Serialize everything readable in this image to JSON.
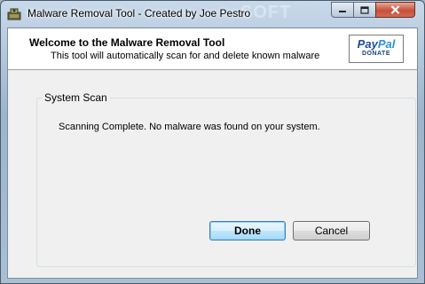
{
  "window": {
    "title": "Malware Removal Tool - Created by Joe Pestro",
    "watermark": "SOFT"
  },
  "header": {
    "welcome": "Welcome to the Malware Removal Tool",
    "subtitle": "This tool will automatically scan for and delete known malware"
  },
  "paypal": {
    "brand_pay": "Pay",
    "brand_pal": "Pal",
    "donate": "DONATE"
  },
  "scan": {
    "group_label": "System Scan",
    "status": "Scanning Complete. No malware was found on your system."
  },
  "buttons": {
    "done": "Done",
    "cancel": "Cancel"
  },
  "icons": {
    "app": "malware-tool-app-icon",
    "minimize": "minimize-icon",
    "maximize": "maximize-icon",
    "close": "close-icon"
  },
  "colors": {
    "default_button_border": "#3c7fb1",
    "close_button": "#c6503a",
    "paypal_blue": "#1e4a9c"
  }
}
